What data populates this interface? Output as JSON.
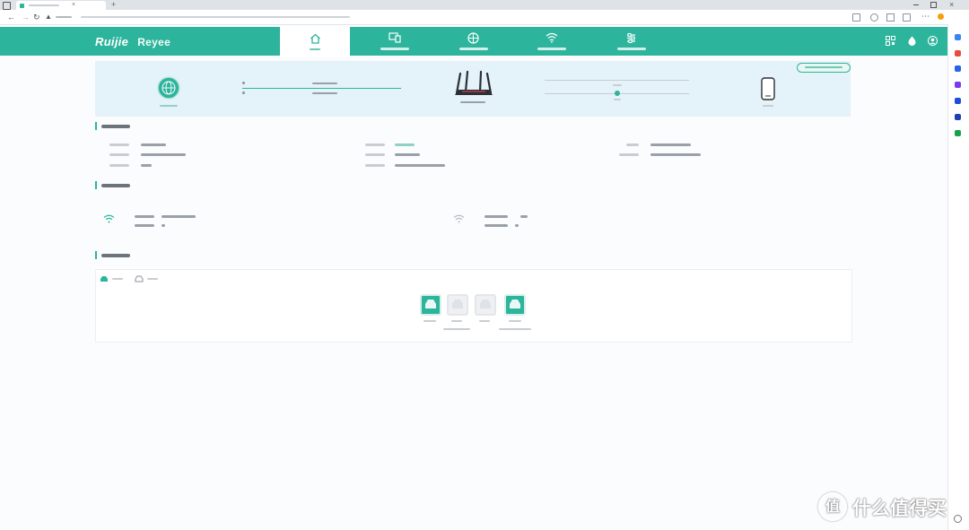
{
  "brand": {
    "part1": "Ruijie",
    "part2": "Reyee"
  },
  "colors": {
    "accent": "#2db49c",
    "topology_bg": "#e4f2f9",
    "port_up": "#2db49c",
    "port_down": "#eef0f3"
  },
  "header": {
    "nav_icons": [
      "home-icon",
      "devices-icon",
      "internet-icon",
      "wifi-icon",
      "advanced-settings-icon"
    ],
    "active_tab": 0,
    "right_icons": [
      "qr-code-icon",
      "drop-icon",
      "user-icon"
    ]
  },
  "topology": {
    "nodes": [
      "internet-globe-icon",
      "router-icon",
      "client-device-icon"
    ]
  },
  "ports": [
    {
      "status": "up"
    },
    {
      "status": "down"
    },
    {
      "status": "down"
    },
    {
      "status": "up"
    }
  ],
  "browser_sidebar_icon_colors": [
    "#3b82f6",
    "#e74c3c",
    "#2563eb",
    "#7c3aed",
    "#1d4ed8",
    "#1e40af",
    "#16a34a"
  ],
  "watermark": {
    "glyph": "值",
    "text": "什么值得买"
  }
}
